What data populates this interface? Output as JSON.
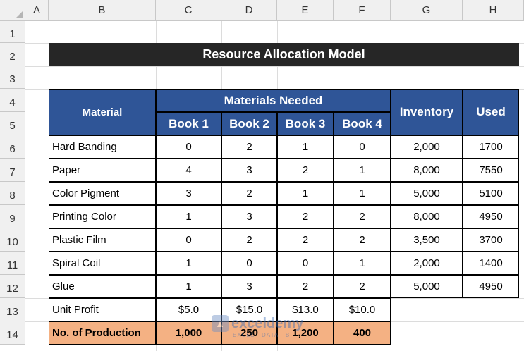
{
  "columns": [
    "A",
    "B",
    "C",
    "D",
    "E",
    "F",
    "G",
    "H"
  ],
  "rows": [
    "1",
    "2",
    "3",
    "4",
    "5",
    "6",
    "7",
    "8",
    "9",
    "10",
    "11",
    "12",
    "13",
    "14"
  ],
  "title": "Resource Allocation Model",
  "headers": {
    "material": "Material",
    "materials_needed": "Materials Needed",
    "books": [
      "Book 1",
      "Book 2",
      "Book 3",
      "Book 4"
    ],
    "inventory": "Inventory",
    "used": "Used"
  },
  "table_rows": [
    {
      "material": "Hard Banding",
      "b1": "0",
      "b2": "2",
      "b3": "1",
      "b4": "0",
      "inventory": "2,000",
      "used": "1700"
    },
    {
      "material": "Paper",
      "b1": "4",
      "b2": "3",
      "b3": "2",
      "b4": "1",
      "inventory": "8,000",
      "used": "7550"
    },
    {
      "material": "Color Pigment",
      "b1": "3",
      "b2": "2",
      "b3": "1",
      "b4": "1",
      "inventory": "5,000",
      "used": "5100"
    },
    {
      "material": "Printing Color",
      "b1": "1",
      "b2": "3",
      "b3": "2",
      "b4": "2",
      "inventory": "8,000",
      "used": "4950"
    },
    {
      "material": "Plastic Film",
      "b1": "0",
      "b2": "2",
      "b3": "2",
      "b4": "2",
      "inventory": "3,500",
      "used": "3700"
    },
    {
      "material": "Spiral Coil",
      "b1": "1",
      "b2": "0",
      "b3": "0",
      "b4": "1",
      "inventory": "2,000",
      "used": "1400"
    },
    {
      "material": "Glue",
      "b1": "1",
      "b2": "3",
      "b3": "2",
      "b4": "2",
      "inventory": "5,000",
      "used": "4950"
    }
  ],
  "unit_profit": {
    "label": "Unit Profit",
    "values": [
      "$5.0",
      "$15.0",
      "$13.0",
      "$10.0"
    ]
  },
  "production": {
    "label": "No. of Production",
    "values": [
      "1,000",
      "250",
      "1,200",
      "400"
    ]
  },
  "watermark": {
    "name": "exceldemy",
    "tagline": "EXCEL · DATA · BI"
  },
  "colors": {
    "header_blue": "#2f5597",
    "title_bg": "#262626",
    "production_orange": "#f4b183"
  }
}
